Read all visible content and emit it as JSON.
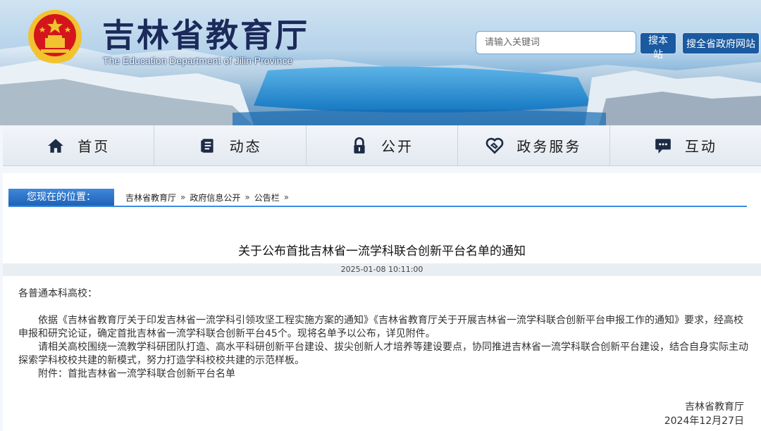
{
  "header": {
    "title": "吉林省教育厅",
    "subtitle": "The Education Department of Jilin Province",
    "search_placeholder": "请输入关键词",
    "btn_site": "搜本站",
    "btn_all": "搜全省政府网站"
  },
  "nav": {
    "items": [
      {
        "label": "首页",
        "icon": "home-icon"
      },
      {
        "label": "动态",
        "icon": "document-icon"
      },
      {
        "label": "公开",
        "icon": "lock-icon"
      },
      {
        "label": "政务服务",
        "icon": "handshake-heart-icon"
      },
      {
        "label": "互动",
        "icon": "chat-icon"
      }
    ]
  },
  "location": {
    "label": "您现在的位置：",
    "crumbs": [
      "吉林省教育厅",
      "政府信息公开",
      "公告栏"
    ],
    "sep": "»"
  },
  "article": {
    "title": "关于公布首批吉林省一流学科联合创新平台名单的通知",
    "datetime": "2025-01-08 10:11:00",
    "salutation": "各普通本科高校：",
    "paragraphs": [
      "依据《吉林省教育厅关于印发吉林省一流学科引领攻坚工程实施方案的通知》《吉林省教育厅关于开展吉林省一流学科联合创新平台申报工作的通知》要求，经高校申报和研究论证，确定首批吉林省一流学科联合创新平台45个。现将名单予以公布，详见附件。",
      "请相关高校围绕一流教学科研团队打造、高水平科研创新平台建设、拔尖创新人才培养等建设要点，协同推进吉林省一流学科联合创新平台建设，结合自身实际主动探索学科校校共建的新模式，努力打造学科校校共建的示范样板。",
      "附件：首批吉林省一流学科联合创新平台名单"
    ],
    "signature_org": "吉林省教育厅",
    "signature_date": "2024年12月27日"
  },
  "colors": {
    "brand_blue": "#1a5aa0",
    "title_navy": "#1b2a5a",
    "emblem_red": "#d4161c",
    "emblem_gold": "#f2c230"
  }
}
